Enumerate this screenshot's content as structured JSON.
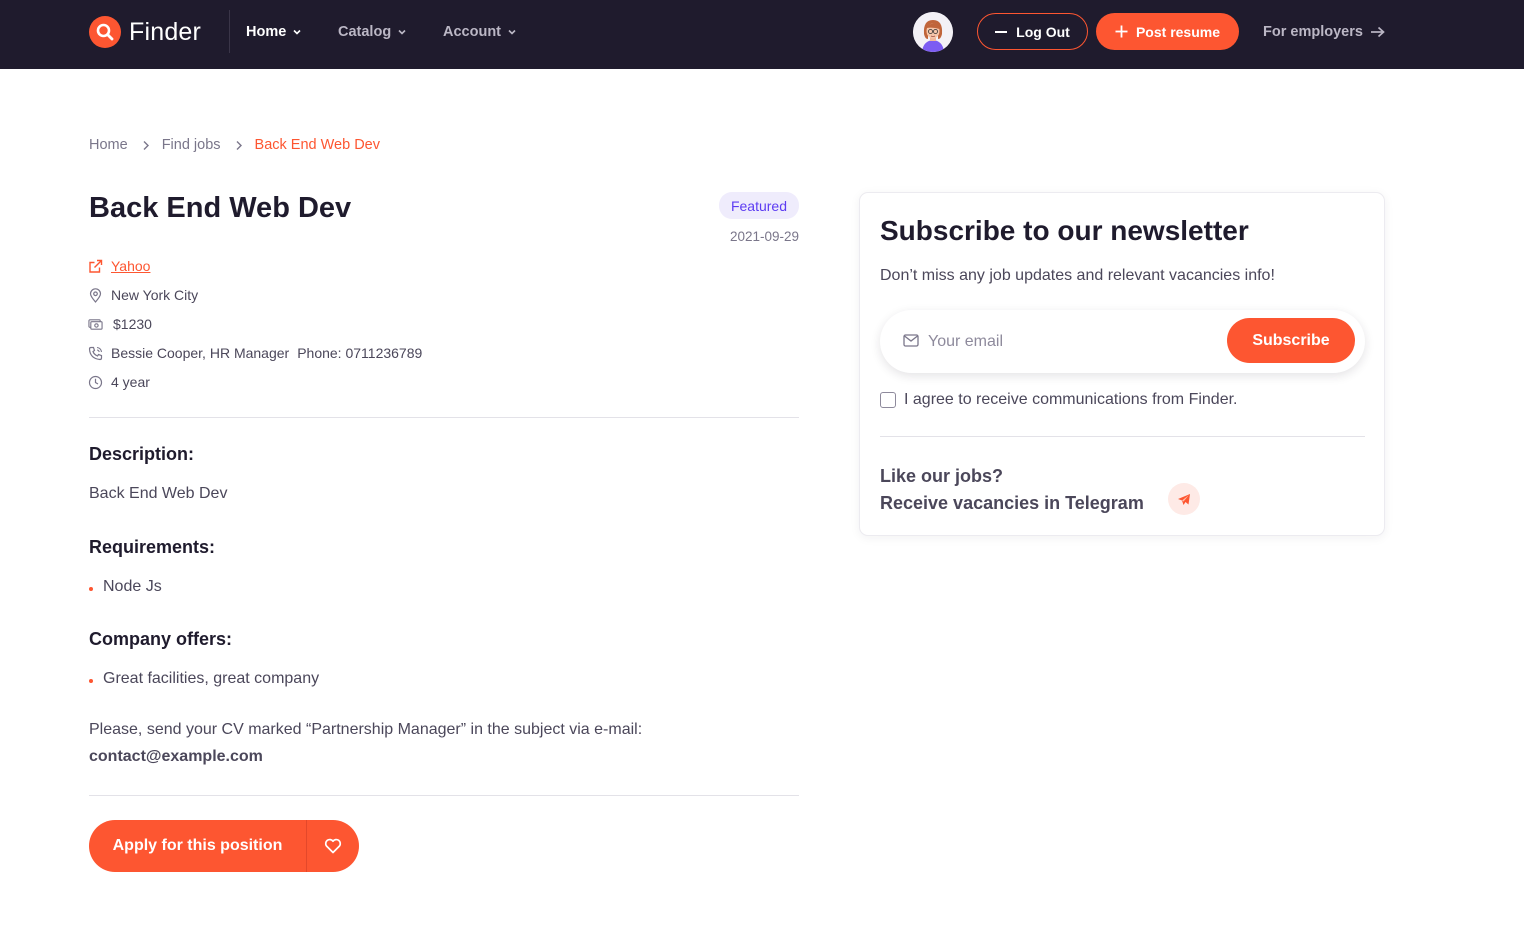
{
  "brand": {
    "name": "Finder"
  },
  "nav": {
    "items": [
      {
        "label": "Home",
        "active": true
      },
      {
        "label": "Catalog",
        "active": false
      },
      {
        "label": "Account",
        "active": false
      }
    ],
    "logout_label": "Log Out",
    "post_resume_label": "Post resume",
    "employers_label": "For employers"
  },
  "breadcrumb": {
    "items": [
      "Home",
      "Find jobs"
    ],
    "current": "Back End Web Dev"
  },
  "job": {
    "title": "Back End Web Dev",
    "badge": "Featured",
    "date": "2021-09-29",
    "company": "Yahoo",
    "location": "New York City",
    "salary": "$1230",
    "contact_person": "Bessie Cooper, HR Manager",
    "phone": "Phone: 0711236789",
    "experience": "4 year"
  },
  "description": {
    "heading": "Description:",
    "text": "Back End Web Dev"
  },
  "requirements": {
    "heading": "Requirements:",
    "items": [
      "Node Js"
    ]
  },
  "offers": {
    "heading": "Company offers:",
    "items": [
      "Great facilities, great company"
    ]
  },
  "cv_note": "Please, send your CV marked “Partnership Manager” in the subject via e-mail:",
  "contact_email": "contact@example.com",
  "apply_label": "Apply for this position",
  "newsletter": {
    "title": "Subscribe to our newsletter",
    "subtitle": "Don’t miss any job updates and relevant vacancies info!",
    "email_placeholder": "Your email",
    "subscribe_label": "Subscribe",
    "agree_label": "I agree to receive communications from Finder.",
    "telegram_line1": "Like our jobs?",
    "telegram_line2": "Receive vacancies in Telegram"
  },
  "colors": {
    "primary": "#fd5631",
    "navbar": "#1f1b2d",
    "badge_bg": "#efecfc",
    "badge_text": "#5d3cf2"
  },
  "icons": [
    "search-icon",
    "chevron-down-icon",
    "plus-icon",
    "arrow-right-icon",
    "chevron-right-icon",
    "external-link-icon",
    "map-pin-icon",
    "money-icon",
    "phone-icon",
    "clock-icon",
    "heart-icon",
    "mail-icon",
    "telegram-icon"
  ]
}
